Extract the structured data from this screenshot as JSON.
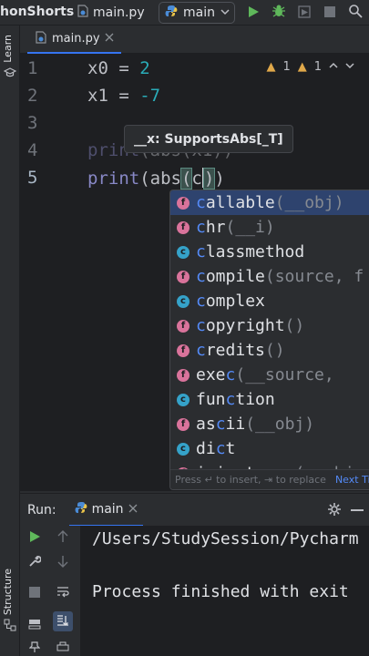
{
  "titlebar": {
    "project_name": "honShorts",
    "file_name": "main.py",
    "run_config": "main"
  },
  "left_strip": {
    "learn_label": "Learn",
    "structure_label": "Structure"
  },
  "editor_tab": {
    "label": "main.py"
  },
  "inspections": {
    "warnings": "1",
    "weak_warnings": "1"
  },
  "editor": {
    "line_numbers": [
      "1",
      "2",
      "3",
      "4",
      "5"
    ],
    "line1": {
      "var": "x0",
      "op": " = ",
      "num": "2"
    },
    "line2": {
      "var": "x1",
      "op": " = ",
      "num": "-7"
    },
    "line4": {
      "func": "print",
      "rest": "(abs(x1))"
    },
    "line5": {
      "func": "print",
      "mid": "(abs",
      "open": "(",
      "typed": "c",
      "close": ")",
      "end": ")"
    }
  },
  "param_hint": {
    "text": "__x: SupportsAbs[_T]"
  },
  "completion": {
    "items": [
      {
        "icon": "f",
        "match": "c",
        "rest": "allable",
        "sig": "(__obj)"
      },
      {
        "icon": "f",
        "match": "c",
        "rest": "hr",
        "sig": "(__i)"
      },
      {
        "icon": "c",
        "match": "c",
        "rest": "lassmethod",
        "sig": ""
      },
      {
        "icon": "f",
        "match": "c",
        "rest": "ompile",
        "sig": "(source, f"
      },
      {
        "icon": "c",
        "match": "c",
        "rest": "omplex",
        "sig": ""
      },
      {
        "icon": "f",
        "match": "c",
        "rest": "opyright",
        "sig": "()"
      },
      {
        "icon": "f",
        "match": "c",
        "rest": "redits",
        "sig": "()"
      },
      {
        "icon": "f",
        "pre": "exe",
        "match": "c",
        "rest": "",
        "sig": "(__source, "
      },
      {
        "icon": "c",
        "pre": "fun",
        "match": "c",
        "rest": "tion",
        "sig": ""
      },
      {
        "icon": "f",
        "pre": "as",
        "match": "c",
        "rest": "ii",
        "sig": "(__obj)"
      },
      {
        "icon": "c",
        "pre": "di",
        "match": "c",
        "rest": "t",
        "sig": ""
      },
      {
        "icon": "f",
        "pre": "isinstan",
        "match": "c",
        "rest": "e",
        "sig": "(__obj"
      }
    ],
    "footer_text": "Press ↵ to insert, ⇥ to replace",
    "footer_link": "Next Ti"
  },
  "run_panel": {
    "label": "Run:",
    "tab": "main",
    "console_lines": [
      "/Users/StudySession/Pycharm",
      "",
      "Process finished with exit"
    ]
  },
  "colors": {
    "accent": "#3574f0",
    "function_icon": "#d9739b",
    "class_icon": "#35a2c9",
    "run_green": "#5fb85b"
  }
}
